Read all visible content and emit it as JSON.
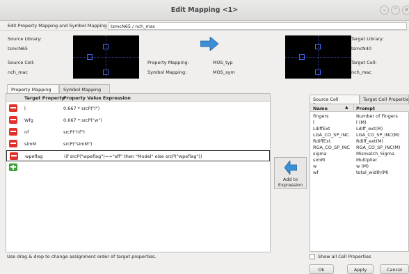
{
  "window": {
    "title": "Edit Mapping <1>"
  },
  "top": {
    "label": "Edit Property Mapping and Symbol Mapping for:",
    "value": "tsmcN65 / nch_mac"
  },
  "source": {
    "library_label": "Source Library:",
    "library": "tsmcN65",
    "cell_label": "Source Cell:",
    "cell": "nch_mac"
  },
  "mapping": {
    "property_label": "Property Mapping:",
    "property_value": "MOS_typ",
    "symbol_label": "Symbol Mapping:",
    "symbol_value": "MOS_sym"
  },
  "target": {
    "library_label": "Target Library:",
    "library": "tsmcN40",
    "cell_label": "Target Cell:",
    "cell": "nch_mac"
  },
  "tabs": [
    "Property Mapping Rule",
    "Symbol Mapping Rule"
  ],
  "table": {
    "headers": [
      "Target Property",
      "Property Value Expression"
    ],
    "rows": [
      {
        "prop": "l",
        "expr": "0.667 * srcP(\"l\")"
      },
      {
        "prop": "Wfg",
        "expr": "0.667 * srcP(\"w\")"
      },
      {
        "prop": "nf",
        "expr": "srcP(\"nf\")"
      },
      {
        "prop": "simM",
        "expr": "srcP(\"simM\")"
      },
      {
        "prop": "wpeflag",
        "expr": "(if srcP(\"wpeflag\")==\"off\" then \"Model\" else srcP(\"wpeflag\"))"
      }
    ]
  },
  "add_expression": {
    "line1": "Add to",
    "line2": "Expression"
  },
  "right_tabs": [
    "Source Cell Properties",
    "Target Cell Properties"
  ],
  "right_table": {
    "headers": [
      "Name",
      "Prompt"
    ],
    "rows": [
      {
        "name": "fingers",
        "prompt": "Number of Fingers"
      },
      {
        "name": "l",
        "prompt": "l (M)"
      },
      {
        "name": "LdiffExt",
        "prompt": "Ldiff_ext(M)"
      },
      {
        "name": "LGA_CO_SP_INC",
        "prompt": "LGA_CO_SP_INC(M)"
      },
      {
        "name": "RdiffExt",
        "prompt": "Rdiff_ext(M)"
      },
      {
        "name": "RGA_CO_SP_INC",
        "prompt": "RGA_CO_SP_INC(M)"
      },
      {
        "name": "sigma",
        "prompt": "Mismatch_Sigma"
      },
      {
        "name": "simM",
        "prompt": "Multiplier"
      },
      {
        "name": "w",
        "prompt": "w (M)"
      },
      {
        "name": "wf",
        "prompt": "total_width(M)"
      }
    ]
  },
  "hint": "Use drag & drop to change assignment order of target properties.",
  "show_all": "Show all Cell Properties",
  "buttons": {
    "ok": "Ok",
    "apply": "Apply",
    "cancel": "Cancel"
  },
  "colors": {
    "accent_arrow": "#3a8fd6",
    "delete": "#e2302a",
    "add": "#3ea23a"
  }
}
